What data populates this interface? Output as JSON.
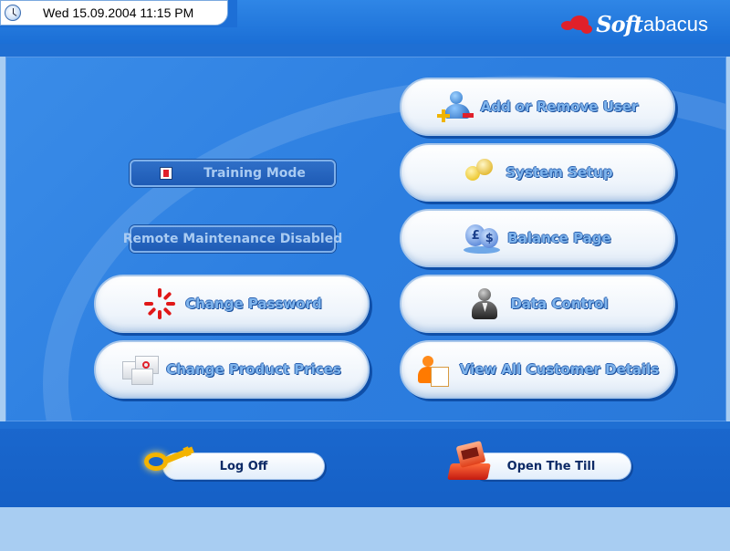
{
  "header": {
    "datetime": "Wed 15.09.2004 11:15 PM",
    "logo_soft": "Soft",
    "logo_abacus": "abacus"
  },
  "left_controls": {
    "training_mode": "Training Mode",
    "remote_maintenance": "Remote Maintenance Disabled",
    "change_password": "Change Password",
    "change_product_prices": "Change Product Prices"
  },
  "right_controls": {
    "add_remove_user": "Add or Remove User",
    "system_setup": "System Setup",
    "balance_page": "Balance Page",
    "data_control": "Data Control",
    "view_customers": "View All Customer Details"
  },
  "footer": {
    "log_off": "Log Off",
    "open_till": "Open The Till"
  },
  "balance_icon": {
    "coin1": "£",
    "coin2": "$"
  },
  "icons": {
    "clock": "clock-icon",
    "logo": "softabacus-logo",
    "training_check": "checkbox-icon",
    "password": "spinner-icon",
    "prices": "boxes-icon",
    "user": "user-add-remove-icon",
    "setup": "keys-icon",
    "balance": "currency-icon",
    "data": "businessman-icon",
    "customers": "customer-document-icon",
    "log_off": "key-icon",
    "till": "cash-register-icon"
  },
  "colors": {
    "panel_blue": "#2c7ee0",
    "header_blue": "#1b6fd6",
    "button_text": "#7fb4ec",
    "accent_red": "#e0202a",
    "key_gold": "#f4b400"
  }
}
